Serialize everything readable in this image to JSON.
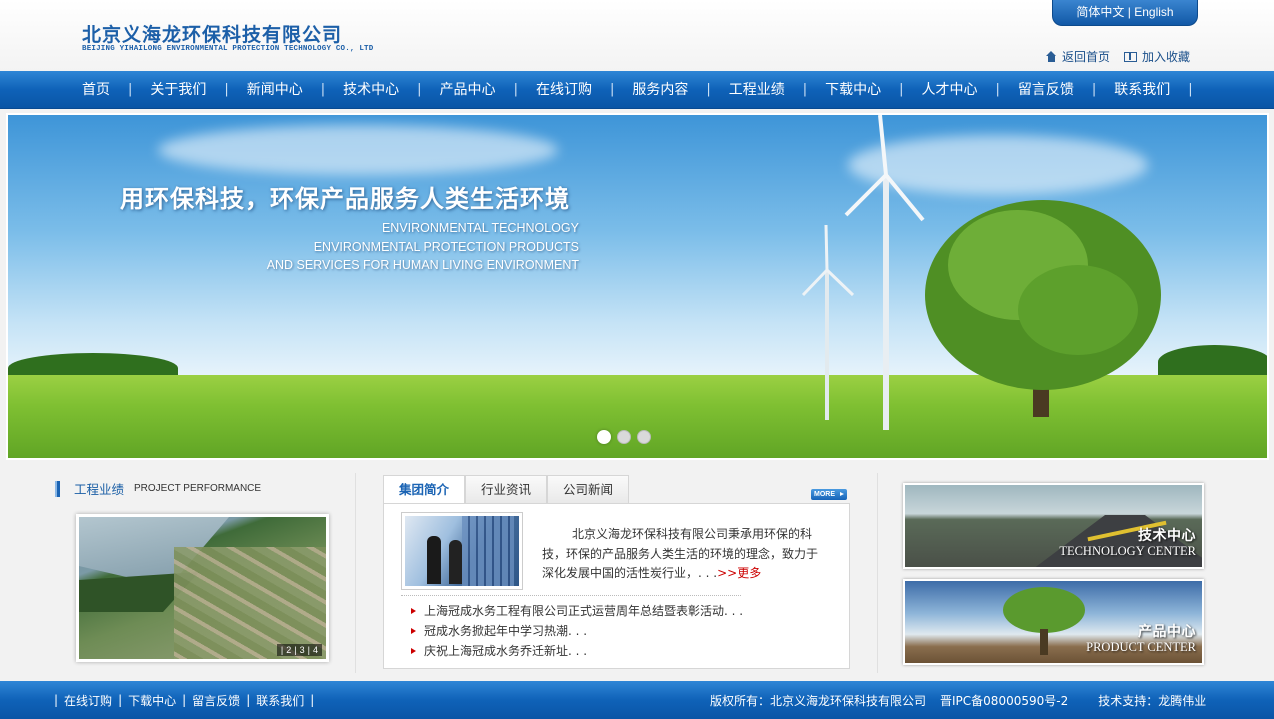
{
  "header": {
    "logo_cn": "北京义海龙环保科技有限公司",
    "logo_en": "BEIJING YIHAILONG ENVIRONMENTAL PROTECTION TECHNOLOGY CO., LTD",
    "lang_cn": "简体中文",
    "lang_sep": "|",
    "lang_en": "English",
    "home_link": "返回首页",
    "favorite_link": "加入收藏"
  },
  "nav": {
    "separator": "|",
    "items": [
      {
        "label": "首页"
      },
      {
        "label": "关于我们"
      },
      {
        "label": "新闻中心"
      },
      {
        "label": "技术中心"
      },
      {
        "label": "产品中心"
      },
      {
        "label": "在线订购"
      },
      {
        "label": "服务内容"
      },
      {
        "label": "工程业绩"
      },
      {
        "label": "下载中心"
      },
      {
        "label": "人才中心"
      },
      {
        "label": "留言反馈"
      },
      {
        "label": "联系我们"
      }
    ]
  },
  "banner": {
    "slogan_cn": "用环保科技，环保产品服务人类生活环境",
    "slogan_en_1": "ENVIRONMENTAL TECHNOLOGY",
    "slogan_en_2": "ENVIRONMENTAL PROTECTION PRODUCTS",
    "slogan_en_3": "AND SERVICES FOR HUMAN LIVING ENVIRONMENT",
    "slide_count": 3,
    "active_slide": 1
  },
  "project": {
    "title_cn": "工程业绩",
    "title_en": "PROJECT PERFORMANCE",
    "pager": [
      "|",
      "2",
      "|",
      "3",
      "|",
      "4"
    ]
  },
  "tabs": {
    "items": [
      {
        "label": "集团简介"
      },
      {
        "label": "行业资讯"
      },
      {
        "label": "公司新闻"
      }
    ],
    "more_label": "MORE",
    "intro_text": "北京义海龙环保科技有限公司秉承用环保的科技，环保的产品服务人类生活的环境的理念，致力于深化发展中国的活性炭行业，. . .",
    "intro_more": ">>更多",
    "news": [
      "上海冠成水务工程有限公司正式运营周年总结暨表彰活动. . .",
      "冠成水务掀起年中学习热潮. . .",
      "庆祝上海冠成水务乔迁新址. . ."
    ]
  },
  "promos": {
    "tech_cn": "技术中心",
    "tech_en": "TECHNOLOGY CENTER",
    "prod_cn": "产品中心",
    "prod_en": "PRODUCT CENTER"
  },
  "footer": {
    "links": [
      "在线订购",
      "下载中心",
      "留言反馈",
      "联系我们"
    ],
    "separator": "|",
    "copyright": "版权所有：北京义海龙环保科技有限公司",
    "icp": "晋IPC备08000590号-2",
    "support": "技术支持：龙腾伟业"
  },
  "colors": {
    "brand_blue": "#1c5fa8",
    "nav_blue": "#0f62b8",
    "accent_red": "#cc0000"
  }
}
